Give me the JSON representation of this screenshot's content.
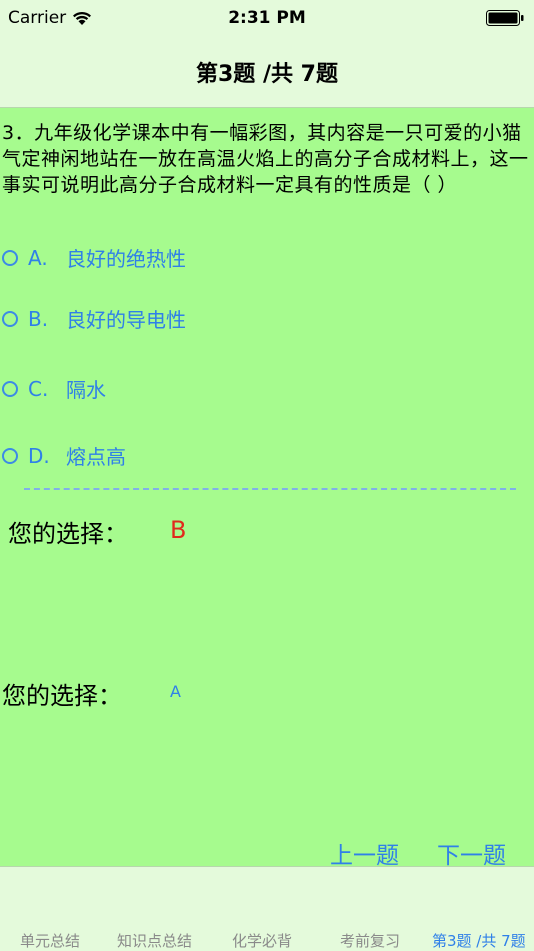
{
  "status_bar": {
    "carrier": "Carrier",
    "time": "2:31 PM"
  },
  "nav": {
    "title": "第3题 /共 7题"
  },
  "question": {
    "text": "3．九年级化学课本中有一幅彩图，其内容是一只可爱的小猫气定神闲地站在一放在高温火焰上的高分子合成材料上，这一事实可说明此高分子合成材料一定具有的性质是（ ）"
  },
  "options": [
    {
      "letter": "A.",
      "text": "良好的绝热性"
    },
    {
      "letter": "B.",
      "text": "良好的导电性"
    },
    {
      "letter": "C.",
      "text": "隔水"
    },
    {
      "letter": "D.",
      "text": "熔点高"
    }
  ],
  "result": {
    "user_label": "您的选择：",
    "user_value": "B",
    "answer_label": "您的选择：",
    "answer_value": "A"
  },
  "buttons": {
    "prev": "上一题",
    "next": "下一题"
  },
  "tabs": [
    {
      "label": "单元总结",
      "active": false
    },
    {
      "label": "知识点总结",
      "active": false
    },
    {
      "label": "化学必背",
      "active": false
    },
    {
      "label": "考前复习",
      "active": false
    },
    {
      "label": "第3题 /共 7题",
      "active": true
    }
  ],
  "colors": {
    "background": "#a6fb8e",
    "bar": "#e4fadb",
    "accent": "#2f80e8",
    "wrong": "#e02a1c",
    "inactive_tab": "#8a8a8a"
  }
}
